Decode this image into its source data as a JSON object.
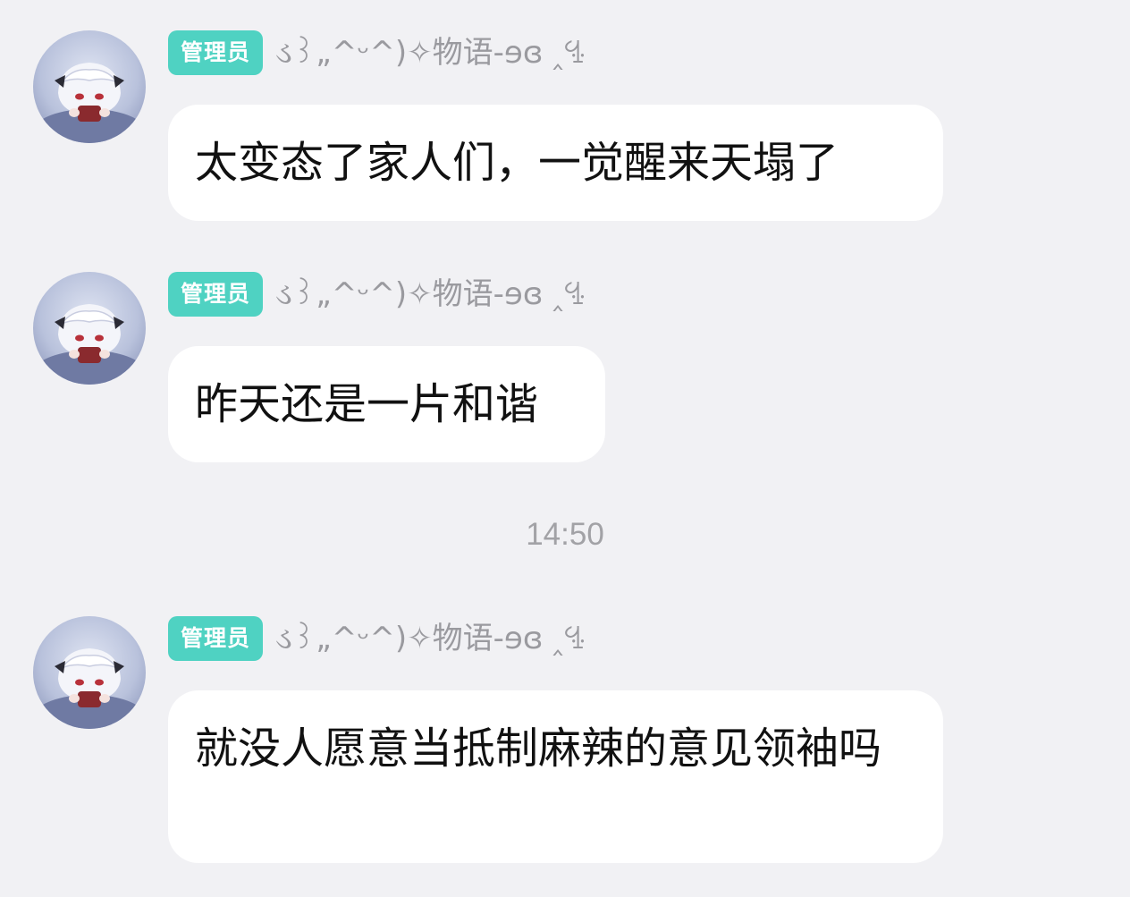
{
  "messages": [
    {
      "badge": "管理员",
      "nickname": "ડ꒱„^ᵕ^)✧物语-ɘɞ ‸ꔈ",
      "text": "太变态了家人们，一觉醒来天塌了"
    },
    {
      "badge": "管理员",
      "nickname": "ડ꒱„^ᵕ^)✧物语-ɘɞ ‸ꔈ",
      "text": "昨天还是一片和谐"
    },
    {
      "badge": "管理员",
      "nickname": "ડ꒱„^ᵕ^)✧物语-ɘɞ ‸ꔈ",
      "text": "就没人愿意当抵制麻辣的意见领袖吗"
    }
  ],
  "timestamp": "14:50",
  "colors": {
    "background": "#f1f1f4",
    "badge": "#4fd2c2",
    "bubble": "#ffffff",
    "nickname": "#9a9a9f",
    "timestamp": "#a2a2a6"
  },
  "icons": {
    "avatar": "anime-avatar-white-hair-girl"
  }
}
